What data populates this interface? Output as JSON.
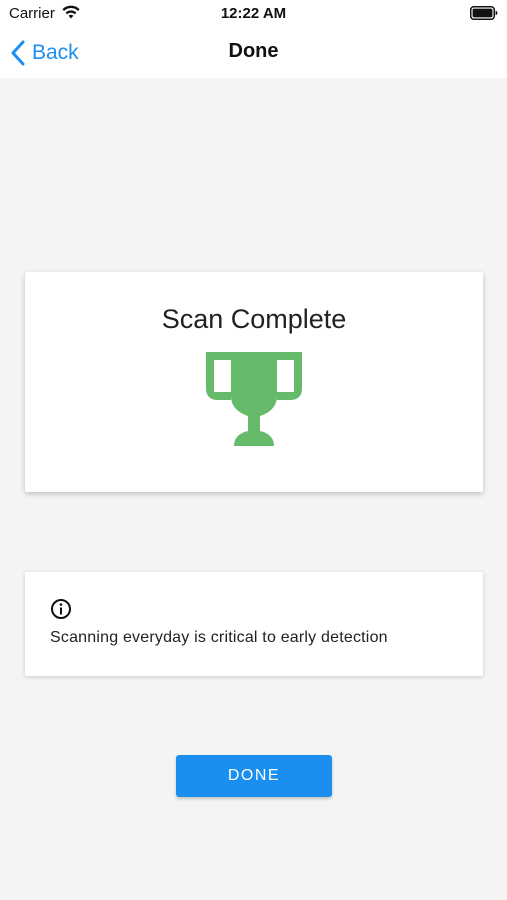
{
  "status_bar": {
    "carrier": "Carrier",
    "time": "12:22 AM",
    "wifi_icon": "wifi-icon",
    "battery_icon": "battery-icon"
  },
  "nav": {
    "back_label": "Back",
    "title": "Done",
    "back_icon": "chevron-left-icon",
    "accent_color": "#1a8ff0"
  },
  "result_card": {
    "title": "Scan Complete",
    "icon": "trophy-icon",
    "icon_color": "#66bb6a"
  },
  "info_card": {
    "icon": "info-icon",
    "text": "Scanning everyday is critical to early detection"
  },
  "done_button": {
    "label": "DONE",
    "color": "#1a8ff0"
  }
}
